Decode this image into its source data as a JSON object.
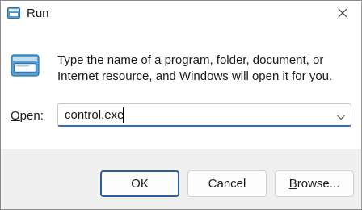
{
  "window": {
    "title": "Run",
    "icon": "run-app-icon",
    "close_icon": "close-icon"
  },
  "main": {
    "message": "Type the name of a program, folder, document, or Internet resource, and Windows will open it for you.",
    "open_label_prefix": "O",
    "open_label_rest": "pen:",
    "open_value": "control.exe",
    "dropdown_icon": "chevron-down-icon"
  },
  "buttons": {
    "ok_label": "OK",
    "cancel_label": "Cancel",
    "browse_prefix": "B",
    "browse_rest": "rowse..."
  },
  "colors": {
    "focus_accent": "#2f6fc0",
    "footer_bg": "#f0f0f0"
  }
}
